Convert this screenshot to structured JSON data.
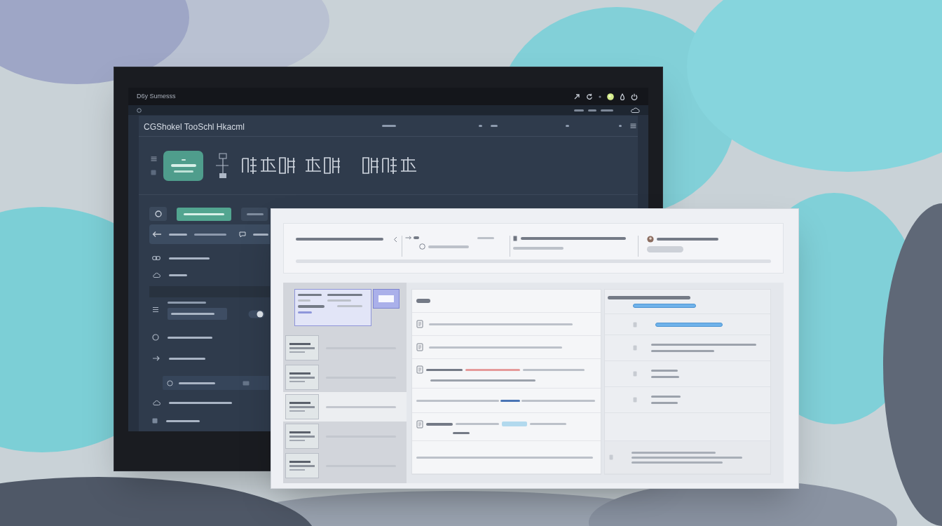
{
  "monitor": {
    "top_bar": {
      "title": "D6y Sumesss"
    },
    "app": {
      "title": "CGShokel TooSchl Hkacml",
      "sidebar": {
        "tabs": [
          {
            "kind": "icon",
            "selected": false
          },
          {
            "kind": "text",
            "selected": true
          },
          {
            "kind": "text",
            "selected": false
          }
        ],
        "rows": [
          {
            "kind": "banner"
          },
          {
            "kind": "item"
          },
          {
            "kind": "item"
          },
          {
            "kind": "band"
          },
          {
            "kind": "field"
          },
          {
            "kind": "item"
          },
          {
            "kind": "item"
          },
          {
            "kind": "box"
          },
          {
            "kind": "item"
          },
          {
            "kind": "item"
          }
        ]
      }
    }
  },
  "front_window": {
    "toolbar": [
      {
        "kind": "title"
      },
      {
        "kind": "status"
      },
      {
        "kind": "detail"
      },
      {
        "kind": "user"
      }
    ],
    "thumbnails": [
      {
        "kind": "preview",
        "selected": true
      },
      {
        "kind": "row",
        "selected": false
      },
      {
        "kind": "row",
        "selected": false
      },
      {
        "kind": "row",
        "selected": true
      },
      {
        "kind": "row",
        "selected": false
      },
      {
        "kind": "row",
        "selected": false
      }
    ],
    "detail_rows": [
      {
        "kind": "heading"
      },
      {
        "kind": "item"
      },
      {
        "kind": "item"
      },
      {
        "kind": "warning"
      },
      {
        "kind": "link"
      },
      {
        "kind": "chip"
      },
      {
        "kind": "text"
      }
    ],
    "info_rows": [
      {
        "kind": "heading"
      },
      {
        "kind": "pill"
      },
      {
        "kind": "text"
      },
      {
        "kind": "text"
      },
      {
        "kind": "text"
      },
      {
        "kind": "blank"
      },
      {
        "kind": "note"
      }
    ]
  }
}
